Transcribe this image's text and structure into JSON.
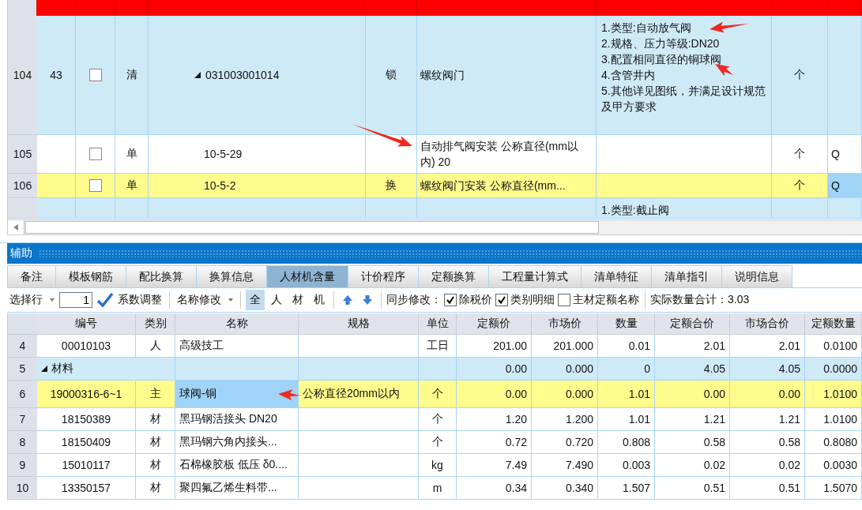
{
  "top_grid": {
    "rows": [
      {
        "number": "104",
        "kind": "group",
        "selected": false,
        "focused": false,
        "seq": "43",
        "checked": false,
        "type": "清",
        "code": "031003001014",
        "expanded": true,
        "mark": "锁",
        "name": "螺纹阀门",
        "features": [
          "1.类型:自动放气阀",
          "2.规格、压力等级:DN20",
          "3.配置相同直径的铜球阀",
          "4.含管井内",
          "5.其他详见图纸，并满足设计规范及甲方要求"
        ],
        "unit": "个"
      },
      {
        "number": "105",
        "kind": "item",
        "selected": false,
        "focused": false,
        "checked": false,
        "type": "单",
        "code": "10-5-29",
        "name": "自动排气阀安装 公称直径(mm以内) 20",
        "unit": "个",
        "column_9": "Q"
      },
      {
        "number": "106",
        "kind": "item",
        "selected": true,
        "focused": true,
        "checked": false,
        "type": "单",
        "code": "10-5-2",
        "mark": "换",
        "name": "螺纹阀门安装 公称直径(mm...",
        "unit": "个",
        "column_9": "Q"
      },
      {
        "kind": "group",
        "selected": false,
        "focused": false,
        "features": [
          "1.类型:截止阀"
        ]
      }
    ]
  },
  "panel": {
    "title": "辅助",
    "tabs": [
      {
        "label": "备注",
        "selected": false
      },
      {
        "label": "模板钢筋",
        "selected": false
      },
      {
        "label": "配比换算",
        "selected": false
      },
      {
        "label": "换算信息",
        "selected": false
      },
      {
        "label": "人材机含量",
        "selected": true
      },
      {
        "label": "计价程序",
        "selected": false
      },
      {
        "label": "定额换算",
        "selected": false
      },
      {
        "label": "工程量计算式",
        "selected": false
      },
      {
        "label": "清单特征",
        "selected": false
      },
      {
        "label": "清单指引",
        "selected": false
      },
      {
        "label": "说明信息",
        "selected": false
      }
    ],
    "toolbar": {
      "row_select": "选择行",
      "row_value": "1",
      "adjust": "系数调整",
      "rename": "名称修改",
      "filters": [
        {
          "label": "全",
          "selected": true
        },
        {
          "label": "人",
          "selected": false
        },
        {
          "label": "材",
          "selected": false
        },
        {
          "label": "机",
          "selected": false
        }
      ],
      "sync_label": "同步修改：",
      "options": [
        {
          "label": "除税价",
          "checked": true
        },
        {
          "label": "类别明细",
          "checked": true
        },
        {
          "label": "主材定额名称",
          "checked": false
        }
      ],
      "total": "实际数量合计：3.03"
    },
    "table": {
      "columns": [
        "编号",
        "类别",
        "名称",
        "规格",
        "单位",
        "定额价",
        "市场价",
        "数量",
        "定额合价",
        "市场合价",
        "定额数量"
      ],
      "rows": [
        {
          "number": "4",
          "kind": "item",
          "selected": false,
          "focused": false,
          "code": "00010103",
          "type": "人",
          "name": "高级技工",
          "unit": "工日",
          "quota_price": "201.00",
          "market_price": "201.000",
          "quantity": "0.01",
          "quota_total": "2.01",
          "market_total": "2.01",
          "quota_quantity": "0.0100"
        },
        {
          "number": "5",
          "kind": "group",
          "selected": false,
          "focused": false,
          "expanded": true,
          "code": "材料",
          "quota_price": "0.00",
          "market_price": "0.000",
          "quantity": "0",
          "quota_total": "4.05",
          "market_total": "4.05",
          "quota_quantity": "0.0000"
        },
        {
          "number": "6",
          "kind": "item",
          "selected": true,
          "focused": true,
          "code": "19000316-6~1",
          "type": "主",
          "name": "球阀-铜",
          "spec": "公称直径20mm以内",
          "unit": "个",
          "quota_price": "0.00",
          "market_price": "0.000",
          "quantity": "1.01",
          "quota_total": "0.00",
          "market_total": "0.00",
          "quota_quantity": "1.0100"
        },
        {
          "number": "7",
          "kind": "item",
          "selected": false,
          "focused": false,
          "code": "18150389",
          "type": "材",
          "name": "黑玛钢活接头 DN20",
          "unit": "个",
          "quota_price": "1.20",
          "market_price": "1.200",
          "quantity": "1.01",
          "quota_total": "1.21",
          "market_total": "1.21",
          "quota_quantity": "1.0100"
        },
        {
          "number": "8",
          "kind": "item",
          "selected": false,
          "focused": false,
          "code": "18150409",
          "type": "材",
          "name": "黑玛钢六角内接头...",
          "unit": "个",
          "quota_price": "0.72",
          "market_price": "0.720",
          "quantity": "0.808",
          "quota_total": "0.58",
          "market_total": "0.58",
          "quota_quantity": "0.8080"
        },
        {
          "number": "9",
          "kind": "item",
          "selected": false,
          "focused": false,
          "code": "15010117",
          "type": "材",
          "name": "石棉橡胶板 低压 δ0....",
          "unit": "kg",
          "quota_price": "7.49",
          "market_price": "7.490",
          "quantity": "0.003",
          "quota_total": "0.02",
          "market_total": "0.02",
          "quota_quantity": "0.0030"
        },
        {
          "number": "10",
          "kind": "item",
          "selected": false,
          "focused": false,
          "code": "13350157",
          "type": "材",
          "name": "聚四氟乙烯生料带...",
          "unit": "m",
          "quota_price": "0.34",
          "market_price": "0.340",
          "quantity": "1.507",
          "quota_total": "0.51",
          "market_total": "0.51",
          "quota_quantity": "1.5070"
        }
      ]
    }
  }
}
